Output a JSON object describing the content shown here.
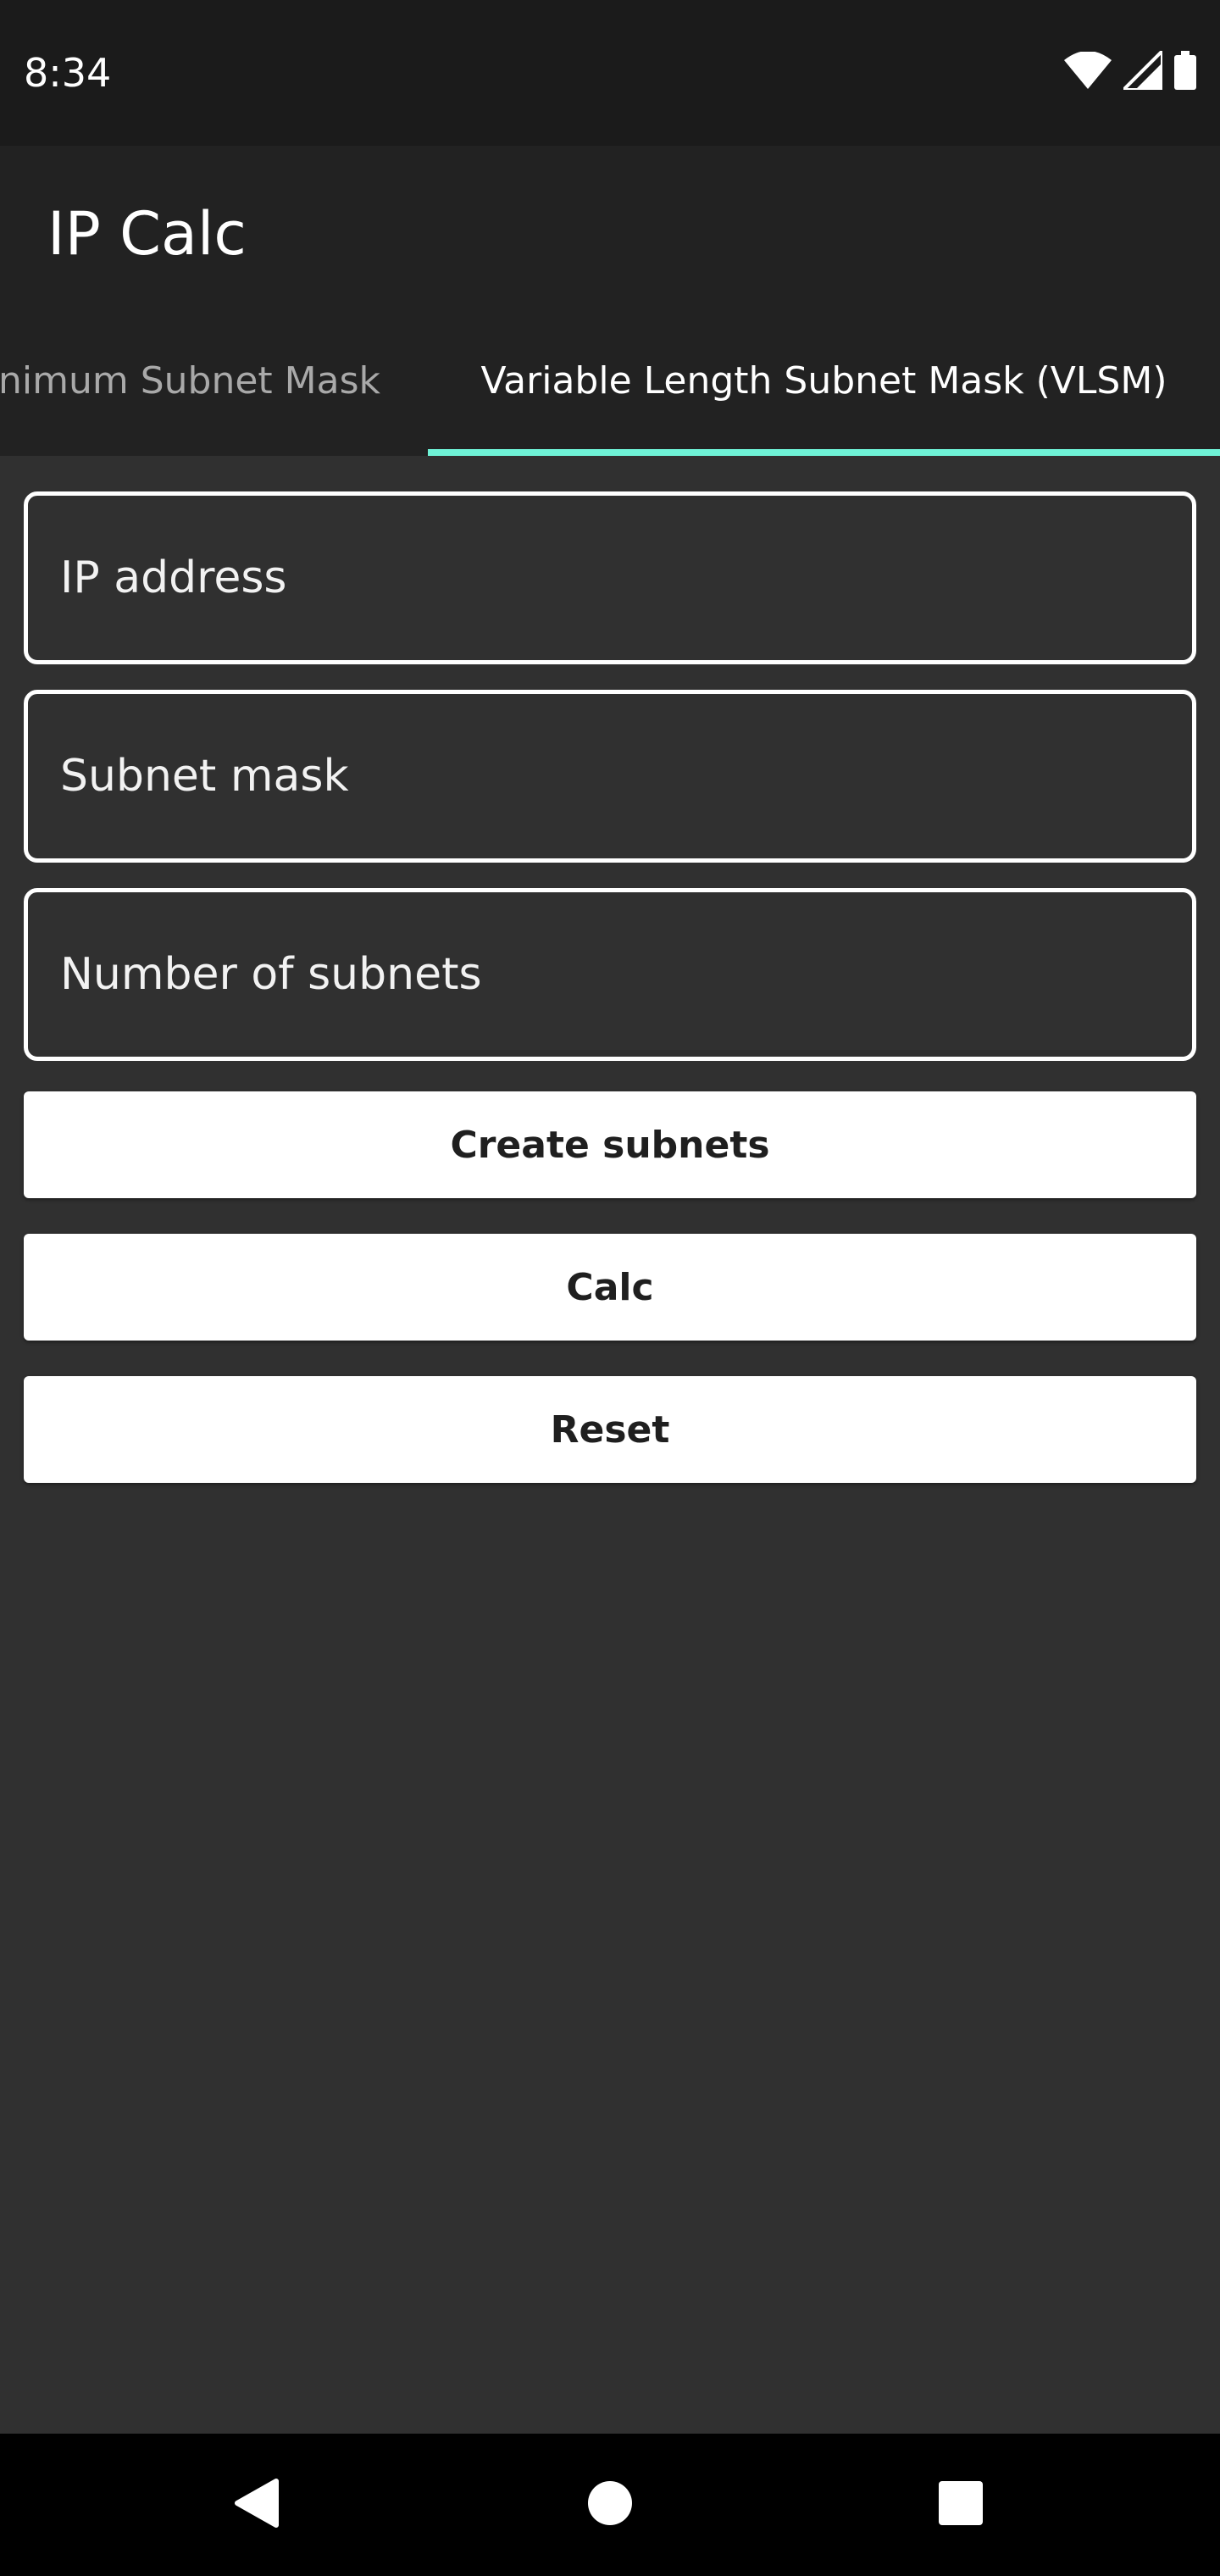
{
  "status_bar": {
    "time": "8:34",
    "icons": [
      "wifi-icon",
      "signal-icon",
      "battery-icon"
    ]
  },
  "app_bar": {
    "title": "IP Calc"
  },
  "tabs": [
    {
      "label": "Minimum Subnet Mask",
      "selected": false
    },
    {
      "label": "Variable Length Subnet Mask (VLSM)",
      "selected": true
    }
  ],
  "form": {
    "ip_address": {
      "value": "",
      "placeholder": "IP address"
    },
    "subnet_mask": {
      "value": "",
      "placeholder": "Subnet mask"
    },
    "number_of_subnets": {
      "value": "",
      "placeholder": "Number of subnets"
    }
  },
  "buttons": {
    "create_subnets": "Create subnets",
    "calc": "Calc",
    "reset": "Reset"
  },
  "nav_bar": {
    "icons": [
      "back-icon",
      "home-icon",
      "recents-icon"
    ]
  },
  "colors": {
    "accent": "#6ff2d6",
    "background": "#303030",
    "app_bar": "#222222",
    "status_bar": "#1b1b1b"
  }
}
